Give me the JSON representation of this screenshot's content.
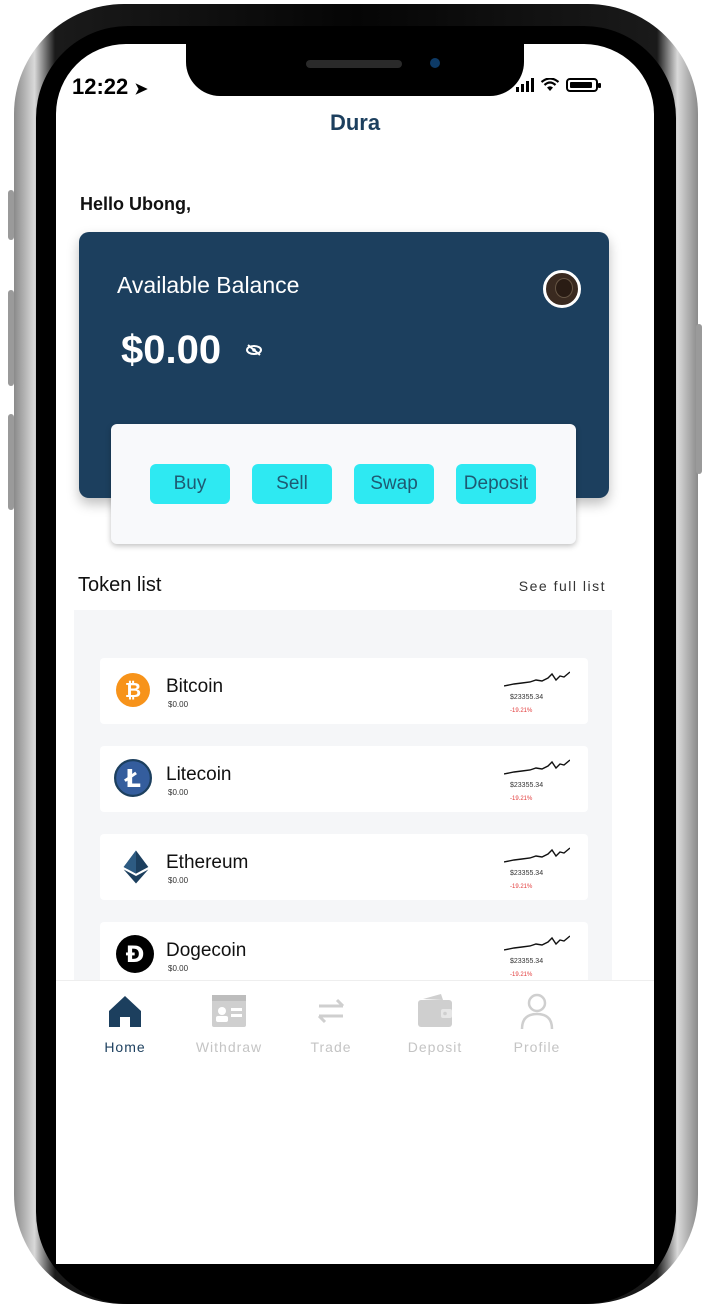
{
  "status_bar": {
    "time": "12:22"
  },
  "app": {
    "title": "Dura"
  },
  "greeting": "Hello Ubong,",
  "balance": {
    "label": "Available Balance",
    "amount": "$0.00"
  },
  "actions": [
    {
      "label": "Buy"
    },
    {
      "label": "Sell"
    },
    {
      "label": "Swap"
    },
    {
      "label": "Deposit"
    }
  ],
  "token_list": {
    "title": "Token list",
    "see_full": "See full list",
    "items": [
      {
        "name": "Bitcoin",
        "balance": "$0.00",
        "price": "$23355.34",
        "change": "-19.21%",
        "icon": "bitcoin-icon",
        "color": "#f7931a"
      },
      {
        "name": "Litecoin",
        "balance": "$0.00",
        "price": "$23355.34",
        "change": "-19.21%",
        "icon": "litecoin-icon",
        "color": "#345d9d"
      },
      {
        "name": "Ethereum",
        "balance": "$0.00",
        "price": "$23355.34",
        "change": "-19.21%",
        "icon": "ethereum-icon",
        "color": "#1c3f5e"
      },
      {
        "name": "Dogecoin",
        "balance": "$0.00",
        "price": "$23355.34",
        "change": "-19.21%",
        "icon": "dogecoin-icon",
        "color": "#000000"
      }
    ]
  },
  "bottom_nav": [
    {
      "label": "Home",
      "icon": "home-icon",
      "active": true
    },
    {
      "label": "Withdraw",
      "icon": "id-card-icon",
      "active": false
    },
    {
      "label": "Trade",
      "icon": "swap-arrows-icon",
      "active": false
    },
    {
      "label": "Deposit",
      "icon": "wallet-icon",
      "active": false
    },
    {
      "label": "Profile",
      "icon": "user-icon",
      "active": false
    }
  ],
  "colors": {
    "primary": "#1c3f5e",
    "accent": "#2ee9f2",
    "negative": "#e23b3b"
  }
}
